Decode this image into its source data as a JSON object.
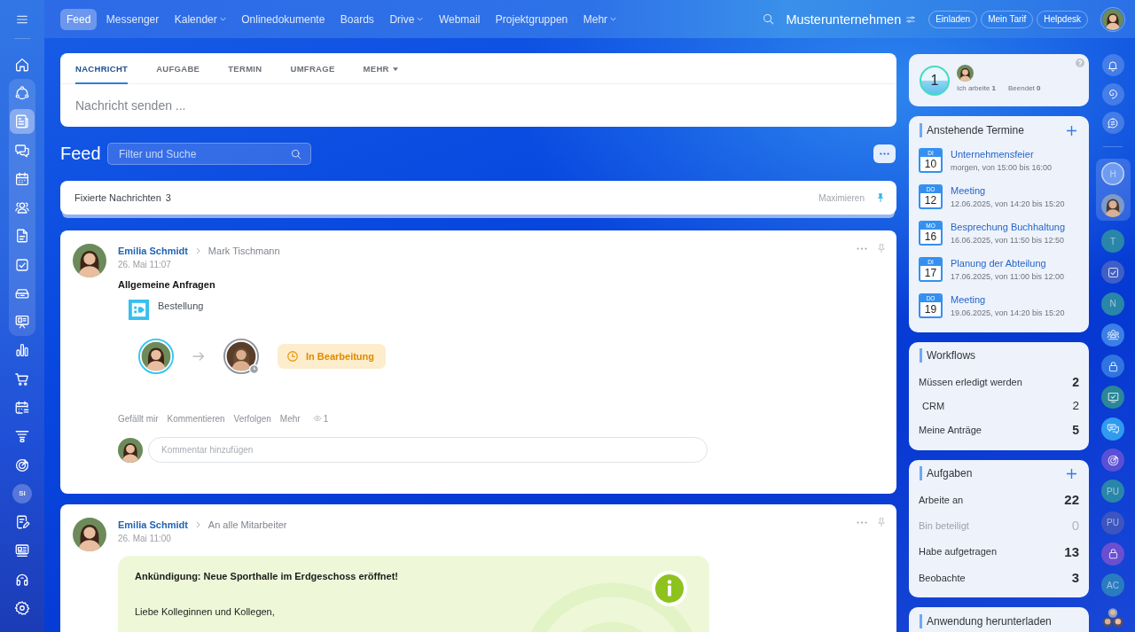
{
  "topbar": {
    "nav": [
      {
        "label": "Feed",
        "selected": true,
        "dropdown": false
      },
      {
        "label": "Messenger",
        "selected": false,
        "dropdown": false
      },
      {
        "label": "Kalender",
        "selected": false,
        "dropdown": true
      },
      {
        "label": "Onlinedokumente",
        "selected": false,
        "dropdown": false
      },
      {
        "label": "Boards",
        "selected": false,
        "dropdown": false
      },
      {
        "label": "Drive",
        "selected": false,
        "dropdown": true
      },
      {
        "label": "Webmail",
        "selected": false,
        "dropdown": false
      },
      {
        "label": "Projektgruppen",
        "selected": false,
        "dropdown": false
      },
      {
        "label": "Mehr",
        "selected": false,
        "dropdown": true
      }
    ],
    "company": "Musterunternehmen",
    "buttons": [
      "Einladen",
      "Mein Tarif",
      "Helpdesk"
    ]
  },
  "sidebar": {
    "home": {
      "selected": false
    },
    "group": [
      {
        "selected": false
      },
      {
        "selected": true
      },
      {
        "selected": false
      },
      {
        "selected": false
      },
      {
        "selected": false
      },
      {
        "selected": false
      },
      {
        "selected": false
      },
      {
        "selected": false
      },
      {
        "selected": false
      }
    ],
    "items": [
      {
        "kind": "icon",
        "selected": false
      },
      {
        "kind": "icon",
        "selected": false
      },
      {
        "kind": "icon",
        "selected": false
      },
      {
        "kind": "icon",
        "selected": false
      },
      {
        "kind": "icon",
        "selected": false
      },
      {
        "kind": "initials",
        "label": "SI",
        "selected": false
      },
      {
        "kind": "icon",
        "selected": false
      },
      {
        "kind": "icon",
        "selected": false
      },
      {
        "kind": "icon",
        "selected": false
      },
      {
        "kind": "icon",
        "selected": false
      }
    ]
  },
  "composer": {
    "tabs": [
      {
        "label": "NACHRICHT",
        "selected": true,
        "dropdown": false
      },
      {
        "label": "AUFGABE",
        "selected": false,
        "dropdown": false
      },
      {
        "label": "TERMIN",
        "selected": false,
        "dropdown": false
      },
      {
        "label": "UMFRAGE",
        "selected": false,
        "dropdown": false
      },
      {
        "label": "MEHR",
        "selected": false,
        "dropdown": true
      }
    ],
    "placeholder": "Nachricht senden ..."
  },
  "feed": {
    "title": "Feed",
    "filter": {
      "placeholder": "Filter und Suche"
    }
  },
  "pinned": {
    "label": "Fixierte Nachrichten",
    "count": "3",
    "action": "Maximieren"
  },
  "posts": [
    {
      "kind": "workflow",
      "author": "Emilia Schmidt",
      "recipient": "Mark Tischmann",
      "date": "26. Mai 11:07",
      "title": "Allgemeine Anfragen",
      "attachment": "Bestellung",
      "status": "In Bearbeitung",
      "actions": [
        "Gefällt mir",
        "Kommentieren",
        "Verfolgen",
        "Mehr"
      ],
      "views": "1",
      "comment_placeholder": "Kommentar hinzufügen"
    },
    {
      "kind": "announcement",
      "author": "Emilia Schmidt",
      "recipient": "An alle Mitarbeiter",
      "date": "26. Mai 11:00",
      "headline": "Ankündigung: Neue Sporthalle im Erdgeschoss eröffnet!",
      "body": "Liebe Kolleginnen und Kollegen,"
    }
  ],
  "widgets": {
    "status": {
      "counter": "1",
      "stats": [
        "Ich arbeite **1**",
        "Beendet **0**"
      ]
    },
    "events": {
      "title": "Anstehende Termine",
      "items": [
        {
          "weekday": "DI",
          "day": "10",
          "title": "Unternehmensfeier",
          "when": "morgen, von 15:00 bis 16:00"
        },
        {
          "weekday": "DO",
          "day": "12",
          "title": "Meeting",
          "when": "12.06.2025, von 14:20 bis 15:20"
        },
        {
          "weekday": "MO",
          "day": "16",
          "title": "Besprechung Buchhaltung",
          "when": "16.06.2025, von 11:50 bis 12:50"
        },
        {
          "weekday": "DI",
          "day": "17",
          "title": "Planung der Abteilung",
          "when": "17.06.2025, von 11:00 bis 12:00"
        },
        {
          "weekday": "DO",
          "day": "19",
          "title": "Meeting",
          "when": "19.06.2025, von 14:20 bis 15:20"
        }
      ]
    },
    "workflows": {
      "title": "Workflows",
      "rows": [
        {
          "label": "Müssen erledigt werden",
          "count": "2",
          "children": [
            {
              "label": "CRM",
              "count": "2"
            }
          ]
        },
        {
          "label": "Meine Anträge",
          "count": "5"
        }
      ]
    },
    "tasks": {
      "title": "Aufgaben",
      "rows": [
        {
          "label": "Arbeite an",
          "count": "22",
          "muted": false
        },
        {
          "label": "Bin beteiligt",
          "count": "0",
          "muted": true
        },
        {
          "label": "Habe aufgetragen",
          "count": "13",
          "muted": false
        },
        {
          "label": "Beobachte",
          "count": "3",
          "muted": false
        }
      ]
    },
    "download": {
      "title": "Anwendung herunterladen"
    }
  },
  "rail": {
    "top": [
      {
        "kind": "icon"
      },
      {
        "kind": "icon"
      },
      {
        "kind": "icon"
      }
    ],
    "pinned": [
      {
        "kind": "initials",
        "label": "H",
        "color": "#6f9cf0"
      },
      {
        "kind": "photo"
      }
    ],
    "chats": [
      {
        "kind": "initials",
        "label": "T",
        "color": "#2a86a8"
      },
      {
        "kind": "icon",
        "color": "#3f5fc6"
      },
      {
        "kind": "initials",
        "label": "N",
        "color": "#2a86a8"
      },
      {
        "kind": "icon",
        "color": "#3b7fe6"
      },
      {
        "kind": "icon",
        "color": "#2f74e0"
      },
      {
        "kind": "icon",
        "color": "#2a8798"
      },
      {
        "kind": "icon",
        "color": "#2f9bf0"
      },
      {
        "kind": "icon",
        "color": "#5a4fd6"
      },
      {
        "kind": "initials",
        "label": "PU",
        "color": "#2a86a8"
      },
      {
        "kind": "initials",
        "label": "PU",
        "color": "#3d55c0"
      },
      {
        "kind": "icon",
        "color": "#6a4fd0"
      },
      {
        "kind": "initials",
        "label": "AC",
        "color": "#2a7cc0"
      },
      {
        "kind": "photo"
      }
    ]
  }
}
